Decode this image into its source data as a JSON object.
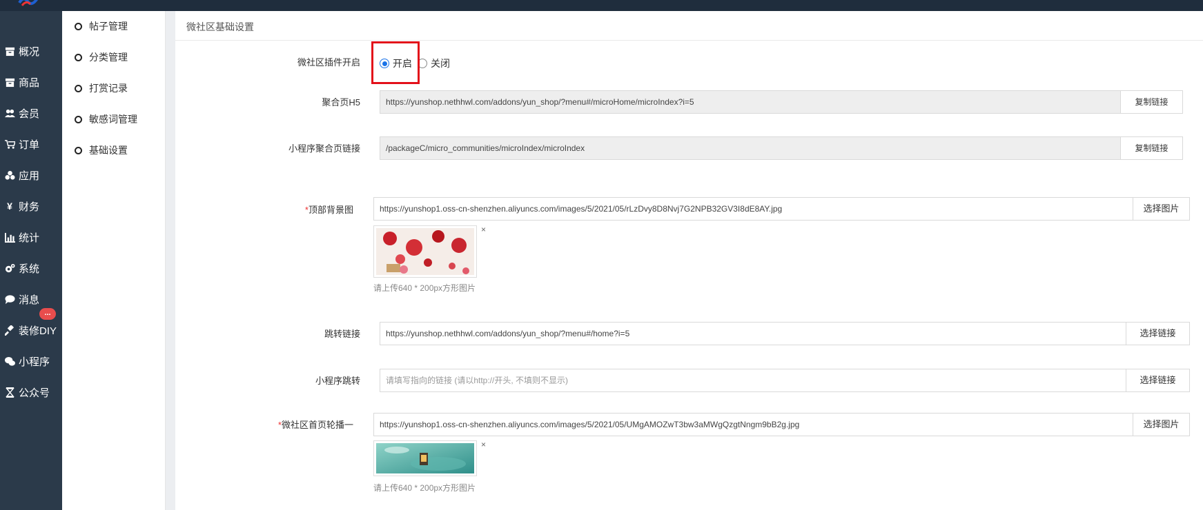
{
  "sidebar": {
    "items": [
      {
        "label": "概况",
        "icon": "archive-icon"
      },
      {
        "label": "商品",
        "icon": "archive-icon"
      },
      {
        "label": "会员",
        "icon": "users-icon"
      },
      {
        "label": "订单",
        "icon": "cart-icon"
      },
      {
        "label": "应用",
        "icon": "cubes-icon"
      },
      {
        "label": "财务",
        "icon": "yen-icon"
      },
      {
        "label": "统计",
        "icon": "bar-chart-icon"
      },
      {
        "label": "系统",
        "icon": "gears-icon"
      },
      {
        "label": "消息",
        "icon": "comment-icon"
      },
      {
        "label": "装修DIY",
        "icon": "gavel-icon"
      },
      {
        "label": "小程序",
        "icon": "wechat-icon"
      },
      {
        "label": "公众号",
        "icon": "hourglass-icon"
      }
    ],
    "message_badge": "..."
  },
  "subnav": {
    "items": [
      "帖子管理",
      "分类管理",
      "打赏记录",
      "敏感词管理",
      "基础设置"
    ]
  },
  "main": {
    "title": "微社区基础设置",
    "plugin_switch": {
      "label": "微社区插件开启",
      "options": [
        "开启",
        "关闭"
      ],
      "selected": "开启"
    },
    "h5_link": {
      "label": "聚合页H5",
      "value": "https://yunshop.nethhwl.com/addons/yun_shop/?menu#/microHome/microIndex?i=5",
      "button": "复制链接"
    },
    "mini_link": {
      "label": "小程序聚合页链接",
      "value": "/packageC/micro_communities/microIndex/microIndex",
      "button": "复制链接"
    },
    "top_bg": {
      "required": "*",
      "label": "顶部背景图",
      "value": "https://yunshop1.oss-cn-shenzhen.aliyuncs.com/images/5/2021/05/rLzDvy8D8Nvj7G2NPB32GV3I8dE8AY.jpg",
      "button": "选择图片",
      "close": "×",
      "hint": "请上传640 * 200px方形图片"
    },
    "jump_link": {
      "label": "跳转链接",
      "value": "https://yunshop.nethhwl.com/addons/yun_shop/?menu#/home?i=5",
      "button": "选择链接"
    },
    "mini_jump": {
      "label": "小程序跳转",
      "placeholder": "请填写指向的链接 (请以http://开头, 不填则不显示)",
      "button": "选择链接"
    },
    "carousel_1": {
      "required": "*",
      "label": "微社区首页轮播一",
      "value": "https://yunshop1.oss-cn-shenzhen.aliyuncs.com/images/5/2021/05/UMgAMOZwT3bw3aMWgQzgtNngm9bB2g.jpg",
      "button": "选择图片",
      "close": "×",
      "hint": "请上传640 * 200px方形图片"
    }
  },
  "colors": {
    "sidebar_bg": "#2b3a4a",
    "topbar_bg": "#1f2d3d",
    "accent": "#1a73e8",
    "highlight": "#e3101a",
    "badge": "#e84d4d"
  }
}
